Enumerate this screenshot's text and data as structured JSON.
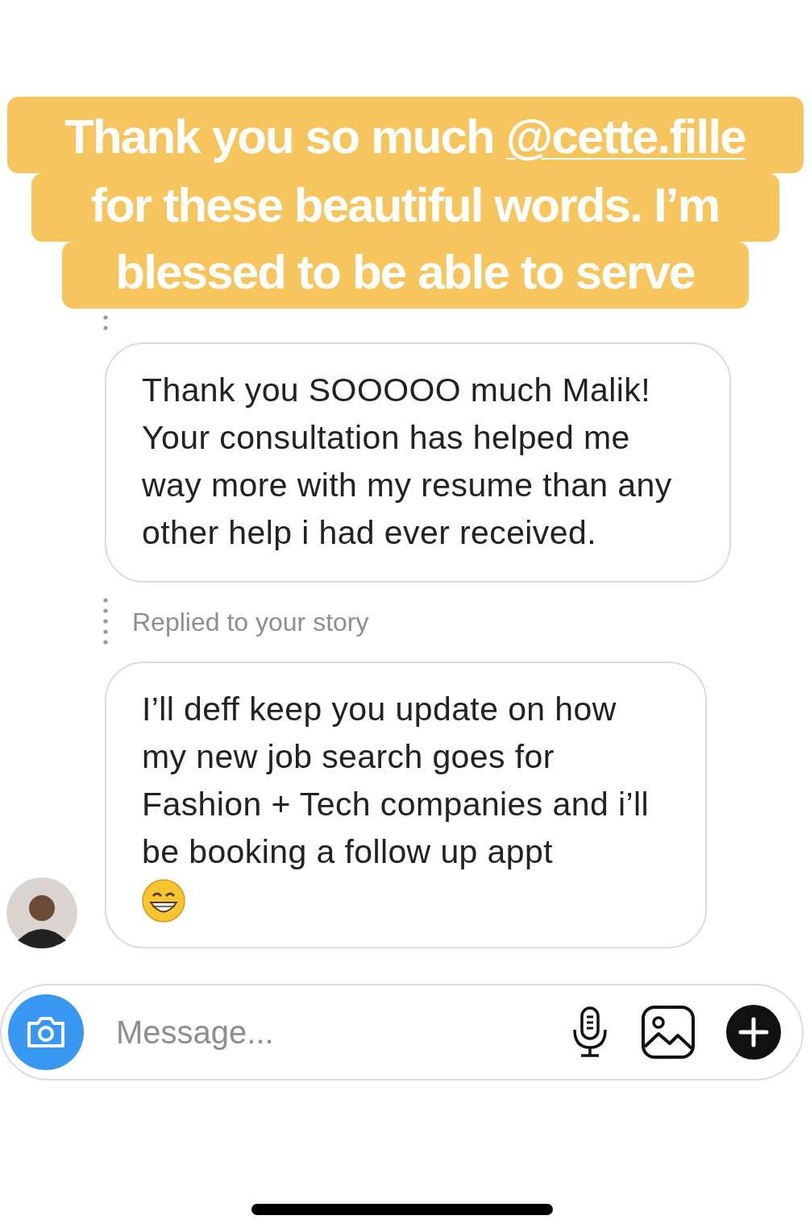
{
  "story_caption": {
    "lines": [
      {
        "text": "Thank you so much ",
        "mention": "@cette.fille"
      },
      {
        "text": "for these beautiful words. I’m"
      },
      {
        "text": "blessed to be able to serve"
      }
    ]
  },
  "thread": [
    {
      "kind": "reply_marker"
    },
    {
      "kind": "message",
      "text": "Thank you SOOOOO much Malik! Your consultation has helped me way more with my resume than any other help i had ever received.",
      "has_emoji": false,
      "show_avatar": false
    },
    {
      "kind": "reply_marker",
      "label": "Replied to your story"
    },
    {
      "kind": "message",
      "text": "I’ll deff keep you update on how my new job search goes for Fashion + Tech companies and i’ll be booking a follow up appt",
      "has_emoji": true,
      "show_avatar": true
    }
  ],
  "composer": {
    "placeholder": "Message..."
  }
}
